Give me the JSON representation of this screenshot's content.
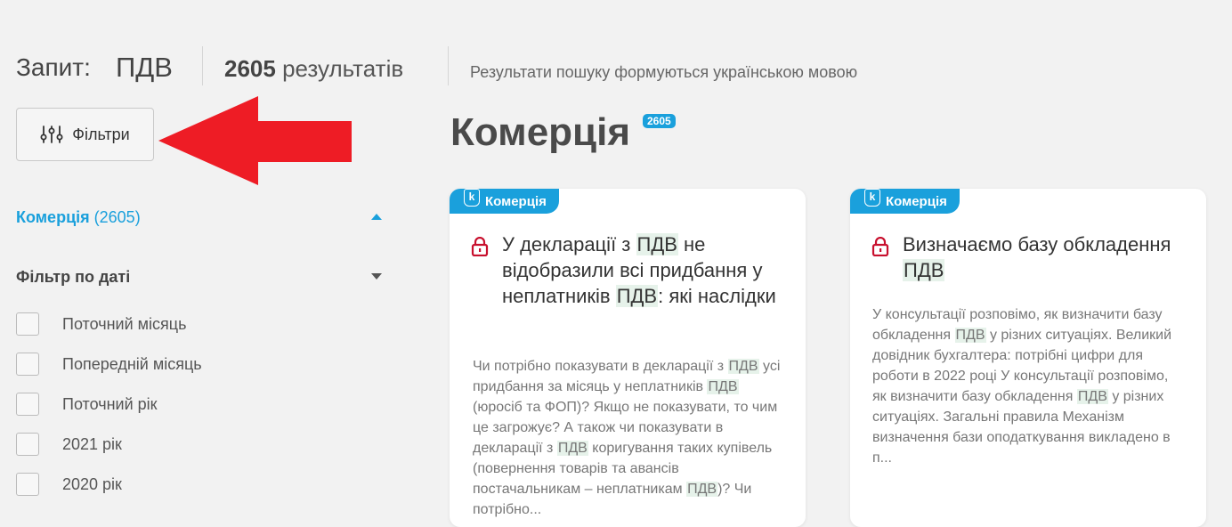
{
  "header": {
    "query_label": "Запит:",
    "query_value": "ПДВ",
    "results_count": "2605",
    "results_word": "результатів",
    "language_note": "Результати пошуку формуються українською мовою"
  },
  "filters_button": {
    "label": "Фільтри",
    "icon": "sliders-icon"
  },
  "sidebar": {
    "category": {
      "label": "Комерція",
      "count": "(2605)"
    },
    "date_filter": {
      "title": "Фільтр по даті",
      "options": [
        "Поточний місяць",
        "Попередній місяць",
        "Поточний рік",
        "2021 рік",
        "2020 рік"
      ]
    }
  },
  "section": {
    "title": "Комерція",
    "badge": "2605"
  },
  "cards": [
    {
      "tag": "Комерція",
      "tag_icon": "k",
      "title_parts": [
        "У декларації з ",
        "ПДВ",
        " не відобразили всі придбання у неплатників ",
        "ПДВ",
        ": які наслідки"
      ],
      "description_parts": [
        "Чи потрібно показувати в декларації з ",
        "ПДВ",
        " усі придбання за місяць у неплатників ",
        "ПДВ",
        " (юросіб та ФОП)? Якщо не показувати, то чим це загрожує? А також чи показувати в декларації з ",
        "ПДВ",
        " коригування таких купівель (повернення товарів та авансів постачальникам – неплатникам ",
        "ПДВ",
        ")? Чи потрібно..."
      ]
    },
    {
      "tag": "Комерція",
      "tag_icon": "k",
      "title_parts": [
        "Визначаємо базу обкладення ",
        "ПДВ"
      ],
      "description_parts": [
        "У консультації розповімо, як визначити базу обкладення ",
        "ПДВ",
        " у різних ситуаціях. Великий довідник бухгалтера: потрібні цифри для роботи в 2022 році У консультації розповімо, як визначити базу обкладення ",
        "ПДВ",
        " у різних ситуаціях. Загальні правила Механізм визначення бази оподаткування викладено в п..."
      ]
    }
  ],
  "colors": {
    "accent": "#1aa0dc",
    "lock": "#c8102e",
    "arrow": "#ee1c25",
    "highlight": "#e6f2ea"
  }
}
